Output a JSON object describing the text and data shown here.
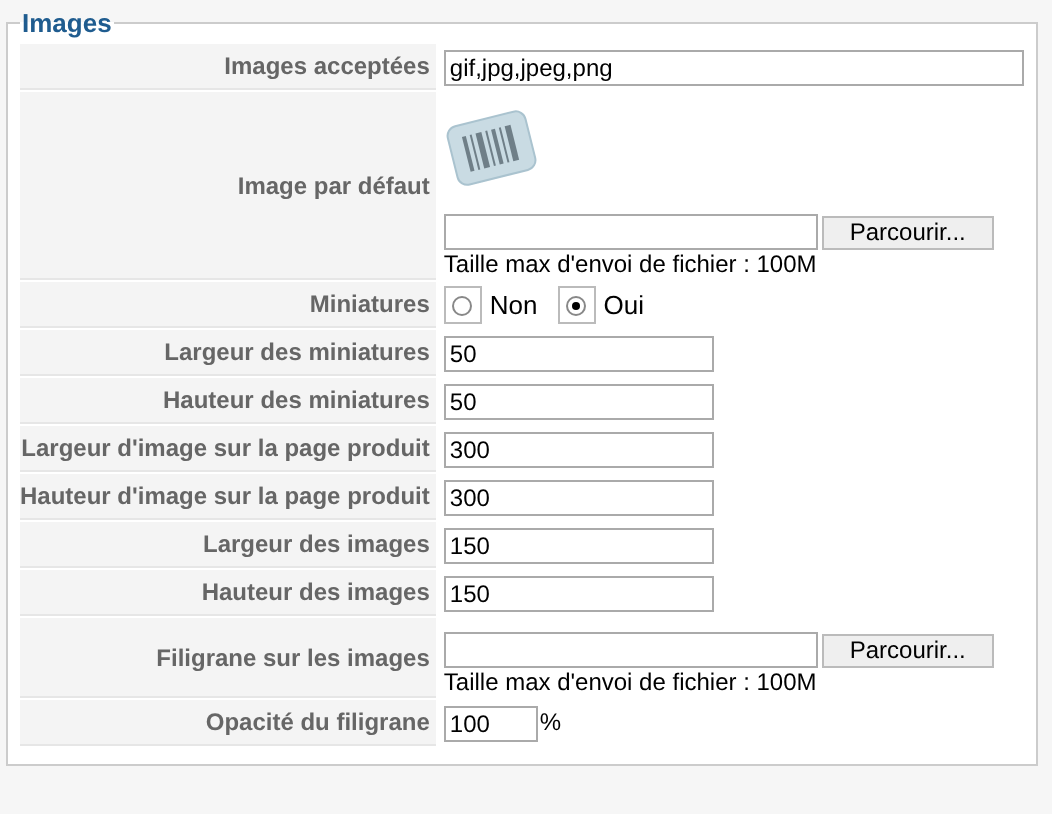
{
  "legend": "Images",
  "rows": [
    {
      "kind": "wide-text",
      "label": "Images acceptées",
      "value": "gif,jpg,jpeg,png"
    },
    {
      "kind": "image-file",
      "label": "Image par défaut",
      "button": "Parcourir...",
      "hint": "Taille max d'envoi de fichier : 100M"
    },
    {
      "kind": "radio",
      "label": "Miniatures",
      "options": [
        {
          "label": "Non",
          "selected": false
        },
        {
          "label": "Oui",
          "selected": true
        }
      ]
    },
    {
      "kind": "text",
      "label": "Largeur des miniatures",
      "value": "50"
    },
    {
      "kind": "text",
      "label": "Hauteur des miniatures",
      "value": "50"
    },
    {
      "kind": "text",
      "label": "Largeur d'image sur la page produit",
      "value": "300"
    },
    {
      "kind": "text",
      "label": "Hauteur d'image sur la page produit",
      "value": "300"
    },
    {
      "kind": "text",
      "label": "Largeur des images",
      "value": "150"
    },
    {
      "kind": "text",
      "label": "Hauteur des images",
      "value": "150"
    },
    {
      "kind": "file",
      "label": "Filigrane sur les images",
      "button": "Parcourir...",
      "hint": "Taille max d'envoi de fichier : 100M"
    },
    {
      "kind": "percent",
      "label": "Opacité du filigrane",
      "value": "100",
      "unit": "%"
    }
  ]
}
